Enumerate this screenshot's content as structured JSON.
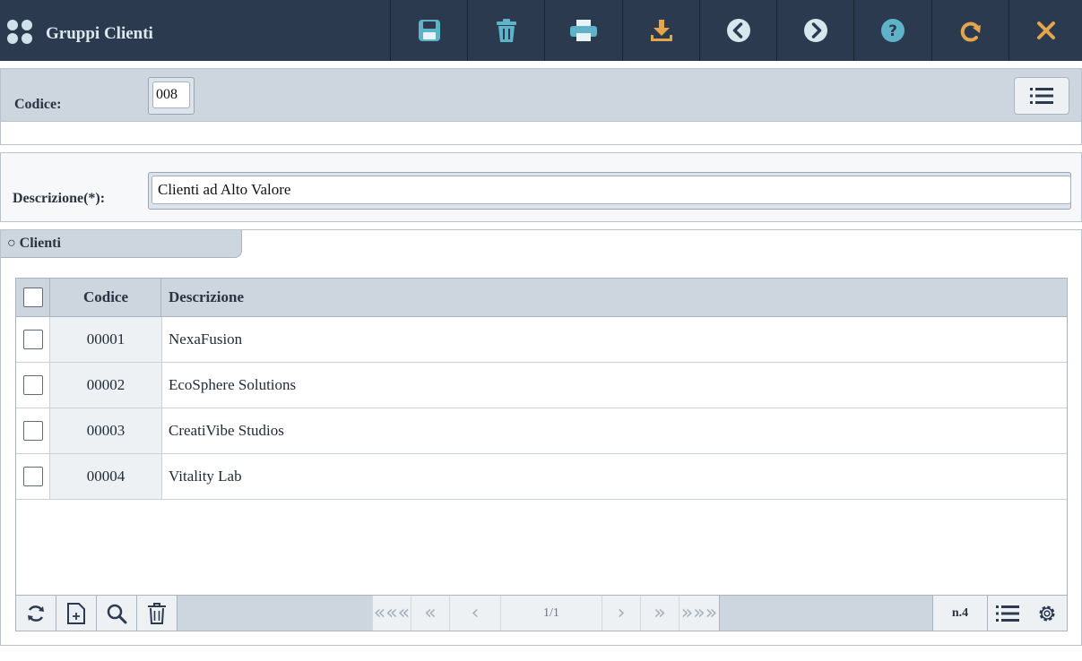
{
  "app": {
    "title": "Gruppi Clienti"
  },
  "toolbar": {
    "buttons": [
      {
        "name": "save",
        "icon": "save-icon",
        "color": "#5fb3c9"
      },
      {
        "name": "delete",
        "icon": "trash-icon",
        "color": "#5fb3c9"
      },
      {
        "name": "print",
        "icon": "printer-icon",
        "color": "#5fb3c9"
      },
      {
        "name": "download",
        "icon": "download-icon",
        "color": "#e3a64b"
      },
      {
        "name": "previous",
        "icon": "chevron-left-circle-icon",
        "color": "#d7e7ee"
      },
      {
        "name": "next",
        "icon": "chevron-right-circle-icon",
        "color": "#d7e7ee"
      },
      {
        "name": "help",
        "icon": "help-circle-icon",
        "color": "#5fb3c9"
      },
      {
        "name": "reload",
        "icon": "redo-icon",
        "color": "#e3a64b"
      },
      {
        "name": "close",
        "icon": "close-icon",
        "color": "#e3a64b"
      }
    ]
  },
  "form": {
    "codice_label": "Codice:",
    "codice_value": "008",
    "descrizione_label": "Descrizione(*):",
    "descrizione_value": "Clienti ad Alto Valore"
  },
  "clienti": {
    "section_label": "○ Clienti",
    "columns": [
      "Codice",
      "Descrizione"
    ],
    "rows": [
      {
        "codice": "00001",
        "descrizione": "NexaFusion"
      },
      {
        "codice": "00002",
        "descrizione": "EcoSphere Solutions"
      },
      {
        "codice": "00003",
        "descrizione": "CreatiVibe Studios"
      },
      {
        "codice": "00004",
        "descrizione": "Vitality Lab"
      }
    ],
    "pager": {
      "first": "«««",
      "prev_page": "«",
      "prev": "‹",
      "page": "1/1",
      "next": "›",
      "next_page": "»",
      "last": "»»»",
      "count": "n.4"
    }
  }
}
